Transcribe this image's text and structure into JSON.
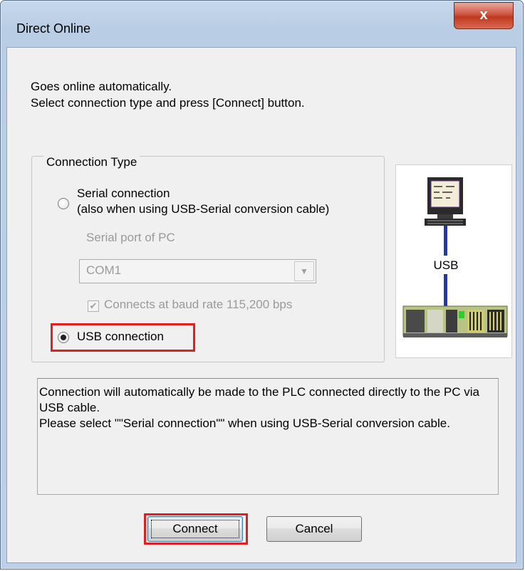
{
  "window": {
    "title": "Direct Online",
    "close_label": "x"
  },
  "intro": {
    "line1": "Goes online automatically.",
    "line2": "Select connection type and press [Connect] button."
  },
  "connection_type": {
    "legend": "Connection Type",
    "serial": {
      "label": "Serial connection",
      "sublabel": "(also when using USB-Serial conversion cable)",
      "selected": false
    },
    "serial_port_label": "Serial port of PC",
    "serial_port_value": "COM1",
    "baud_checkbox_label": "Connects at baud rate 115,200 bps",
    "baud_checked": true,
    "usb": {
      "label": "USB connection",
      "selected": true
    }
  },
  "illustration": {
    "usb_label": "USB"
  },
  "description": "Connection will automatically be made to the PLC connected directly to the PC via USB cable.\nPlease select \"\"Serial connection\"\" when using USB-Serial conversion cable.",
  "buttons": {
    "connect": "Connect",
    "cancel": "Cancel"
  },
  "colors": {
    "highlight": "#e21f1f",
    "title_bar": "#b9cde4",
    "close_button": "#c0371f"
  }
}
